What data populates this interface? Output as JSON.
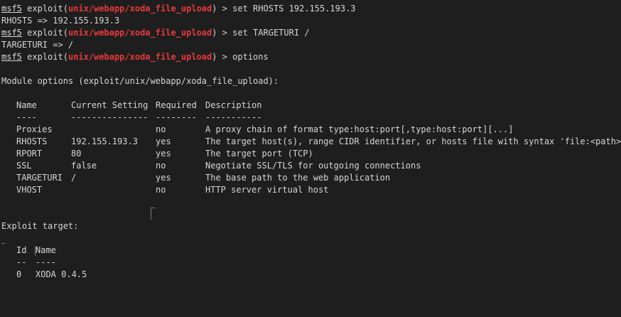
{
  "session": {
    "prompt_label": "msf5",
    "prompt_cmd": "exploit(",
    "module_path": "unix/webapp/xoda_file_upload",
    "prompt_end": ") > ",
    "cmd1": "set RHOSTS 192.155.193.3",
    "out1": "RHOSTS => 192.155.193.3",
    "cmd2": "set TARGETURI /",
    "out2": "TARGETURI => /",
    "cmd3": "options"
  },
  "options": {
    "title": "Module options (exploit/unix/webapp/xoda_file_upload):",
    "headers": [
      "Name",
      "Current Setting",
      "Required",
      "Description"
    ],
    "separators": [
      "----",
      "---------------",
      "--------",
      "-----------"
    ],
    "rows": [
      [
        "Proxies",
        "",
        "no",
        "A proxy chain of format type:host:port[,type:host:port][...]"
      ],
      [
        "RHOSTS",
        "192.155.193.3",
        "yes",
        "The target host(s), range CIDR identifier, or hosts file with syntax 'file:<path>'"
      ],
      [
        "RPORT",
        "80",
        "yes",
        "The target port (TCP)"
      ],
      [
        "SSL",
        "false",
        "no",
        "Negotiate SSL/TLS for outgoing connections"
      ],
      [
        "TARGETURI",
        "/",
        "yes",
        "The base path to the web application"
      ],
      [
        "VHOST",
        "",
        "no",
        "HTTP server virtual host"
      ]
    ]
  },
  "target": {
    "title": "Exploit target:",
    "headers": [
      "Id",
      "Name"
    ],
    "separators": [
      "--",
      "----"
    ],
    "rows": [
      [
        "0",
        "XODA 0.4.5"
      ]
    ]
  }
}
